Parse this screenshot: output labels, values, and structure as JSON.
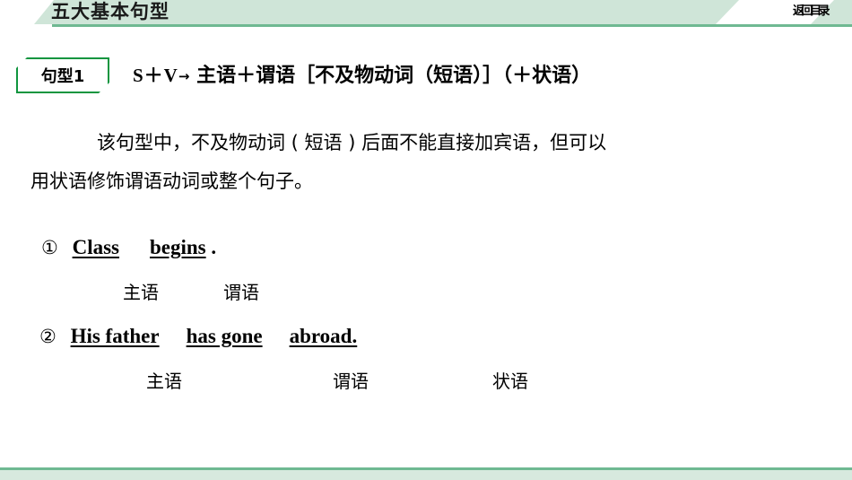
{
  "header": {
    "title": "五大基本句型",
    "back_label": "返回目录",
    "band_color": "#cfe5d8",
    "rule_color": "#6fb992"
  },
  "pattern": {
    "badge_label": "句型1",
    "badge_border_color": "#10953f",
    "formula_sv": "S＋V",
    "formula_arrow": "→",
    "formula_cn": "主语＋谓语［不及物动词（短语）］（＋状语）"
  },
  "explanation": {
    "line1": "该句型中，不及物动词 ( 短语 ) 后面不能直接加宾语，但可以",
    "line2": "用状语修饰谓语动词或整个句子。"
  },
  "examples": [
    {
      "number": "①",
      "parts": [
        "Class",
        "begins"
      ],
      "terminator": ".",
      "roles": [
        "主语",
        "谓语"
      ]
    },
    {
      "number": "②",
      "parts": [
        "His father",
        "has gone",
        "abroad."
      ],
      "terminator": "",
      "roles": [
        "主语",
        "谓语",
        "状语"
      ]
    }
  ],
  "footer": {
    "rule_color": "#6fb992",
    "band_color": "#d7e9de"
  }
}
